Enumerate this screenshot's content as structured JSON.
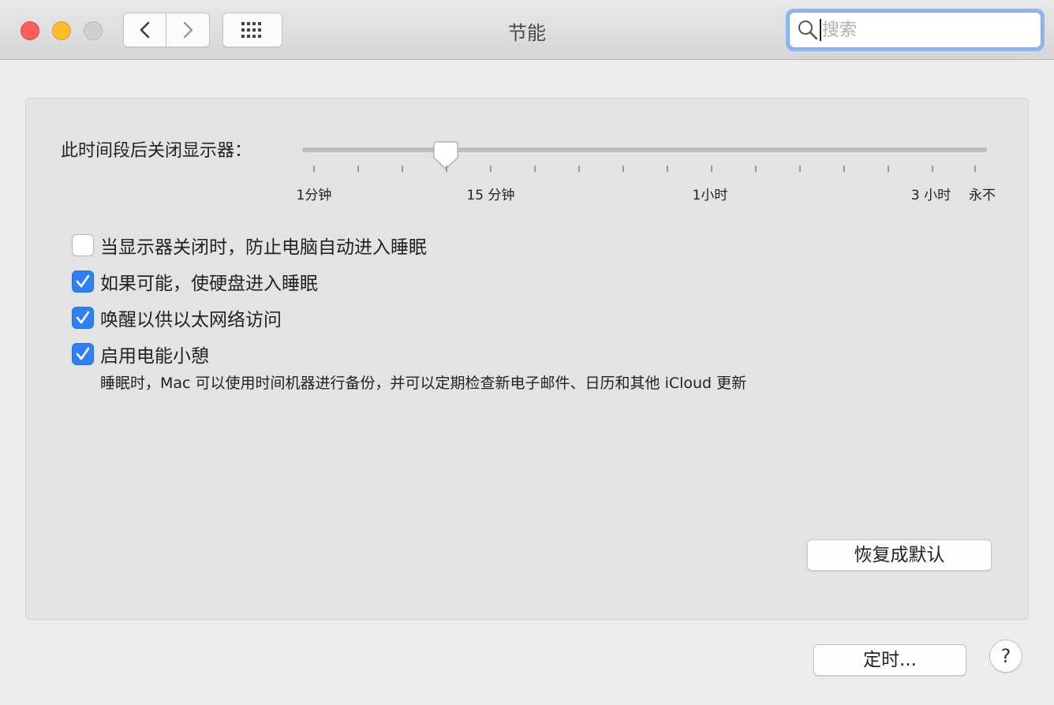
{
  "window": {
    "title": "节能",
    "search": {
      "placeholder": "搜索",
      "value": ""
    }
  },
  "icons": {
    "close": "close-window-icon",
    "minimize": "minimize-window-icon",
    "zoom": "zoom-window-icon",
    "back": "chevron-left-icon",
    "forward": "chevron-right-icon",
    "show_all": "grid-icon",
    "search": "magnifier-icon",
    "check": "checkmark-icon"
  },
  "colors": {
    "close": "#fc5f57",
    "minimize": "#fdbc2e",
    "zoom_disabled": "#cfcfcf",
    "accent": "#2f80f4",
    "search_focus_ring": "#8fb6ee"
  },
  "display_sleep": {
    "label": "此时间段后关闭显示器：",
    "ticks": [
      "1分钟",
      "15 分钟",
      "1小时",
      "3 小时",
      "永不"
    ],
    "selected_fraction": 0.21
  },
  "options": [
    {
      "label": "当显示器关闭时，防止电脑自动进入睡眠",
      "checked": false
    },
    {
      "label": "如果可能，使硬盘进入睡眠",
      "checked": true
    },
    {
      "label": "唤醒以供以太网络访问",
      "checked": true
    },
    {
      "label": "启用电能小憩",
      "checked": true
    }
  ],
  "power_nap_note": "睡眠时，Mac 可以使用时间机器进行备份，并可以定期检查新电子邮件、日历和其他 iCloud 更新",
  "buttons": {
    "restore_defaults": "恢复成默认",
    "schedule": "定时...",
    "help": "?"
  }
}
